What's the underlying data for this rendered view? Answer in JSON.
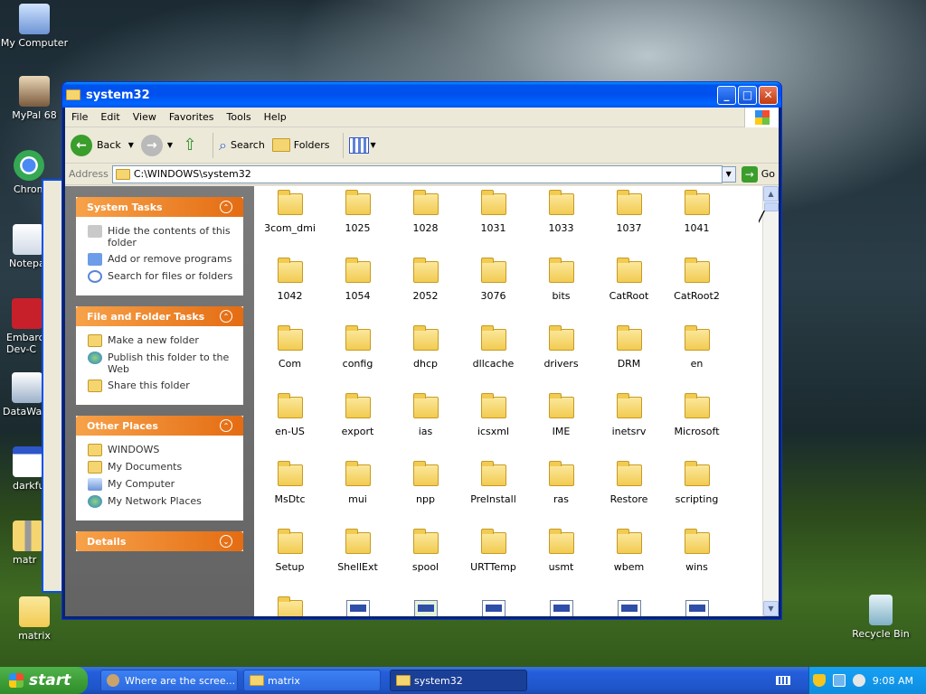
{
  "desktop": {
    "icons": [
      {
        "label": "My Computer"
      },
      {
        "label": "MyPal 68"
      },
      {
        "label": "Chrom"
      },
      {
        "label": "Notepa"
      },
      {
        "label": "Embarca\nDev-C"
      },
      {
        "label": "DataWa"
      },
      {
        "label": "darkfu"
      },
      {
        "label": "matr"
      },
      {
        "label": "matrix"
      }
    ],
    "recycle_bin": "Recycle Bin"
  },
  "window": {
    "title": "system32",
    "menu": [
      "File",
      "Edit",
      "View",
      "Favorites",
      "Tools",
      "Help"
    ],
    "toolbar": {
      "back": "Back",
      "search": "Search",
      "folders": "Folders"
    },
    "address": {
      "label": "Address",
      "value": "C:\\WINDOWS\\system32",
      "go": "Go"
    },
    "panels": {
      "system_tasks": {
        "title": "System Tasks",
        "items": [
          "Hide the contents of this folder",
          "Add or remove programs",
          "Search for files or folders"
        ]
      },
      "file_folder_tasks": {
        "title": "File and Folder Tasks",
        "items": [
          "Make a new folder",
          "Publish this folder to the Web",
          "Share this folder"
        ]
      },
      "other_places": {
        "title": "Other Places",
        "items": [
          "WINDOWS",
          "My Documents",
          "My Computer",
          "My Network Places"
        ]
      },
      "details": {
        "title": "Details"
      }
    },
    "folders": [
      "3com_dmi",
      "1025",
      "1028",
      "1031",
      "1033",
      "1037",
      "1041",
      "1042",
      "1054",
      "2052",
      "3076",
      "bits",
      "CatRoot",
      "CatRoot2",
      "Com",
      "config",
      "dhcp",
      "dllcache",
      "drivers",
      "DRM",
      "en",
      "en-US",
      "export",
      "ias",
      "icsxml",
      "IME",
      "inetsrv",
      "Microsoft",
      "MsDtc",
      "mui",
      "npp",
      "PreInstall",
      "ras",
      "Restore",
      "scripting",
      "Setup",
      "ShellExt",
      "spool",
      "URTTemp",
      "usmt",
      "wbem",
      "wins"
    ]
  },
  "taskbar": {
    "start": "start",
    "tasks": [
      "Where are the scree...",
      "matrix",
      "system32"
    ],
    "clock": "9:08 AM"
  }
}
